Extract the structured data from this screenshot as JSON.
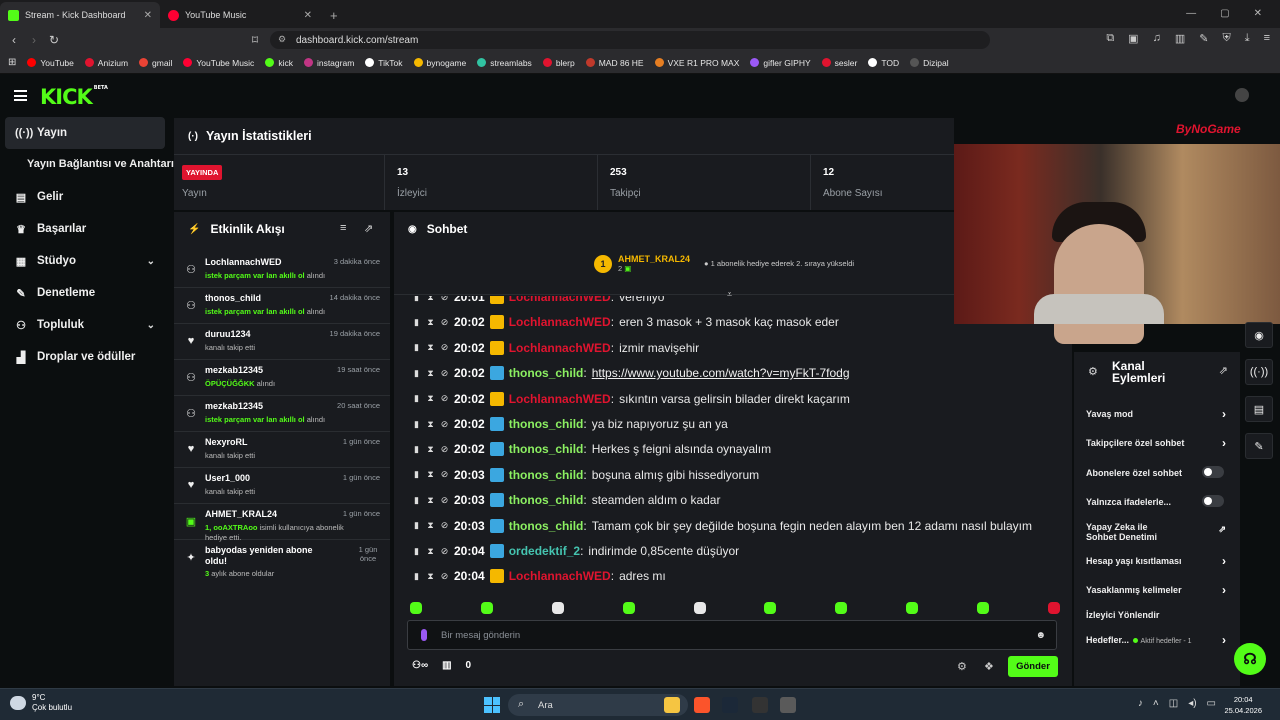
{
  "browser": {
    "tabs": [
      {
        "title": "Stream - Kick Dashboard",
        "active": true,
        "color": "#53fc18"
      },
      {
        "title": "YouTube Music",
        "active": false,
        "color": "#ff0033"
      }
    ],
    "url": "dashboard.kick.com/stream",
    "bookmarks": [
      {
        "label": "YouTube",
        "color": "#ff0000"
      },
      {
        "label": "Anizium",
        "color": "#e0142f"
      },
      {
        "label": "gmail",
        "color": "#ea4335"
      },
      {
        "label": "YouTube Music",
        "color": "#ff0033"
      },
      {
        "label": "kick",
        "color": "#53fc18"
      },
      {
        "label": "instagram",
        "color": "#c13584"
      },
      {
        "label": "TikTok",
        "color": "#ffffff"
      },
      {
        "label": "bynogame",
        "color": "#f5b800"
      },
      {
        "label": "streamlabs",
        "color": "#31c3a2"
      },
      {
        "label": "blerp",
        "color": "#e0142f"
      },
      {
        "label": "MAD 86 HE",
        "color": "#c0392b"
      },
      {
        "label": "VXE R1 PRO MAX",
        "color": "#e67e22"
      },
      {
        "label": "gifler GIPHY",
        "color": "#9b59f5"
      },
      {
        "label": "sesler",
        "color": "#e0142f"
      },
      {
        "label": "TOD",
        "color": "#ffffff"
      },
      {
        "label": "Dizipal",
        "color": "#555555"
      }
    ]
  },
  "kick": {
    "logo": "KICK",
    "logo_tag": "BETA"
  },
  "sidebar": {
    "items": [
      {
        "label": "Yayın",
        "icon": "broadcast-icon",
        "active": true
      },
      {
        "label": "Gelir",
        "icon": "chart-icon"
      },
      {
        "label": "Başarılar",
        "icon": "trophy-icon"
      },
      {
        "label": "Stüdyo",
        "icon": "studio-icon",
        "expandable": true
      },
      {
        "label": "Denetleme",
        "icon": "wrench-icon"
      },
      {
        "label": "Topluluk",
        "icon": "people-icon",
        "expandable": true
      },
      {
        "label": "Droplar ve ödüller",
        "icon": "gift-icon"
      }
    ],
    "sub_item": "Yayın Bağlantısı ve Anahtarı"
  },
  "stats": {
    "title": "Yayın İstatistikleri",
    "live_badge": "YAYINDA",
    "cells": [
      {
        "label": "Yayın",
        "value": ""
      },
      {
        "label": "İzleyici",
        "value": "13"
      },
      {
        "label": "Takipçi",
        "value": "253"
      },
      {
        "label": "Abone Sayısı",
        "value": "12"
      }
    ]
  },
  "activity": {
    "title": "Etkinlik Akışı",
    "items": [
      {
        "name": "LochlannachWED",
        "time": "3 dakika önce",
        "desc_green": "istek parçam var lan akıllı ol",
        "desc": " alındı",
        "icon": "points-icon"
      },
      {
        "name": "thonos_child",
        "time": "14 dakika önce",
        "desc_green": "istek parçam var lan akıllı ol",
        "desc": " alındı",
        "icon": "points-icon"
      },
      {
        "name": "duruu1234",
        "time": "19 dakika önce",
        "desc_green": "",
        "desc": "kanalı takip etti",
        "icon": "heart-icon"
      },
      {
        "name": "mezkab12345",
        "time": "19 saat önce",
        "desc_green": "ÖPÜÇÜĞĞKK",
        "desc": " alındı",
        "icon": "points-icon"
      },
      {
        "name": "mezkab12345",
        "time": "20 saat önce",
        "desc_green": "istek parçam var lan akıllı ol",
        "desc": " alındı",
        "icon": "points-icon"
      },
      {
        "name": "NexyroRL",
        "time": "1 gün önce",
        "desc_green": "",
        "desc": "kanalı takip etti",
        "icon": "heart-icon"
      },
      {
        "name": "User1_000",
        "time": "1 gün önce",
        "desc_green": "",
        "desc": "kanalı takip etti",
        "icon": "heart-icon"
      },
      {
        "name": "AHMET_KRAL24",
        "time": "1 gün önce",
        "desc_green": "1, ooAXTRAoo",
        "desc": " isimli kullanıcıya abonelik hediye etti.",
        "icon": "gift-icon"
      }
    ],
    "last": {
      "name": "babyodas yeniden abone oldu!",
      "time": "1 gün önce",
      "desc_green": "3",
      "desc": " aylık abone oldular"
    }
  },
  "chat": {
    "title": "Sohbet",
    "pinned": {
      "badge": "1",
      "name": "AHMET_KRAL24",
      "sub_count": "2",
      "message": "1 abonelik hediye ederek 2. sıraya yükseldi"
    },
    "messages": [
      {
        "time": "20:01",
        "user": "LochlannachWED",
        "color": "#e0142f",
        "badge": "#f5b800",
        "text": "vereniyo"
      },
      {
        "time": "20:02",
        "user": "LochlannachWED",
        "color": "#e0142f",
        "badge": "#f5b800",
        "text": "eren 3 masok + 3 masok kaç masok eder"
      },
      {
        "time": "20:02",
        "user": "LochlannachWED",
        "color": "#e0142f",
        "badge": "#f5b800",
        "text": "izmir mavişehir"
      },
      {
        "time": "20:02",
        "user": "thonos_child",
        "color": "#8cf062",
        "badge": "#3ba7e0",
        "text": "https://www.youtube.com/watch?v=myFkT-7fodg",
        "link": true
      },
      {
        "time": "20:02",
        "user": "LochlannachWED",
        "color": "#e0142f",
        "badge": "#f5b800",
        "text": "sıkıntın varsa gelirsin bilader direkt kaçarım"
      },
      {
        "time": "20:02",
        "user": "thonos_child",
        "color": "#8cf062",
        "badge": "#3ba7e0",
        "text": "ya biz napıyoruz şu an ya"
      },
      {
        "time": "20:02",
        "user": "thonos_child",
        "color": "#8cf062",
        "badge": "#3ba7e0",
        "text": "Herkes ş feigni alsında oynayalım"
      },
      {
        "time": "20:03",
        "user": "thonos_child",
        "color": "#8cf062",
        "badge": "#3ba7e0",
        "text": "boşuna almış gibi hissediyorum"
      },
      {
        "time": "20:03",
        "user": "thonos_child",
        "color": "#8cf062",
        "badge": "#3ba7e0",
        "text": "steamden aldım o kadar"
      },
      {
        "time": "20:03",
        "user": "thonos_child",
        "color": "#8cf062",
        "badge": "#3ba7e0",
        "text": "Tamam çok bir şey değilde boşuna fegin neden alayım ben 12 adamı nasıl bulayım"
      },
      {
        "time": "20:04",
        "user": "ordedektif_2",
        "color": "#45c4b0",
        "badge": "#3ba7e0",
        "text": "indirimde 0,85cente düşüyor"
      },
      {
        "time": "20:04",
        "user": "LochlannachWED",
        "color": "#e0142f",
        "badge": "#f5b800",
        "text": "adres mı"
      }
    ],
    "input_placeholder": "Bir mesaj gönderin",
    "points_count": "0",
    "send_label": "Gönder"
  },
  "channel_actions": {
    "title": "Kanal Eylemleri",
    "rows": [
      {
        "label": "Yavaş mod",
        "type": "arrow"
      },
      {
        "label": "Takipçilere özel sohbet",
        "type": "arrow"
      },
      {
        "label": "Abonelere özel sohbet",
        "type": "toggle"
      },
      {
        "label": "Yalnızca ifadelerle...",
        "type": "toggle"
      },
      {
        "label": "Yapay Zeka ile Sohbet Denetimi",
        "type": "external"
      },
      {
        "label": "Hesap yaşı kısıtlaması",
        "type": "arrow"
      },
      {
        "label": "Yasaklanmış kelimeler",
        "type": "arrow"
      },
      {
        "label": "İzleyici Yönlendir",
        "type": "none"
      },
      {
        "label": "Hedefler...",
        "type": "arrow",
        "sub": "Aktif hedefler - 1"
      }
    ]
  },
  "webcam_overlay": "ByNoGame",
  "taskbar": {
    "weather_temp": "9°C",
    "weather_desc": "Çok bulutlu",
    "search_label": "Ara",
    "time": "20:04",
    "date": "25.04.2026"
  }
}
